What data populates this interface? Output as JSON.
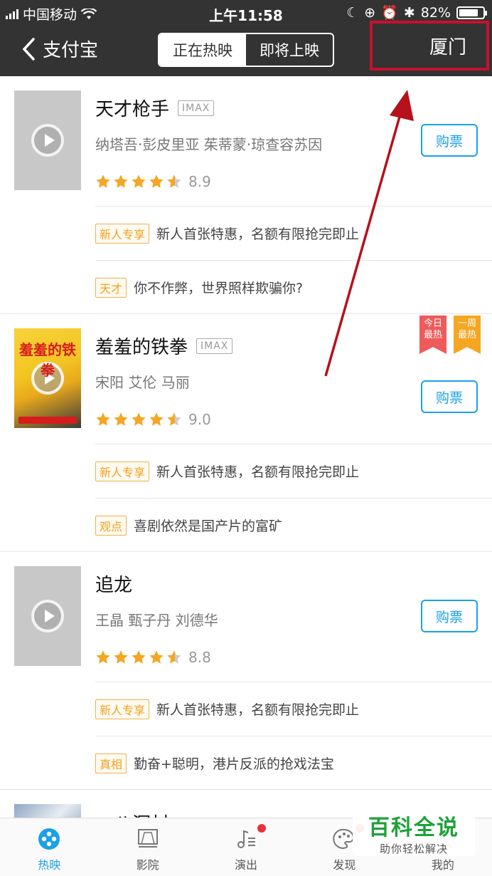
{
  "status": {
    "carrier": "中国移动",
    "time": "上午11:58",
    "battery": "82%",
    "battery_level": 0.82
  },
  "nav": {
    "back_label": "支付宝",
    "tabs": [
      "正在热映",
      "即将上映"
    ],
    "active_tab": 0,
    "city": "厦门"
  },
  "movies": [
    {
      "title": "天才枪手",
      "format": "IMAX",
      "cast": "纳塔吾·彭皮里亚 茱蒂蒙·琼查容苏因",
      "score": "8.9",
      "buy_label": "购票",
      "promos": [
        {
          "tag": "新人专享",
          "text": "新人首张特惠，名额有限抢完即止"
        },
        {
          "tag": "天才",
          "text": "你不作弊，世界照样欺骗你?"
        }
      ]
    },
    {
      "title": "羞羞的铁拳",
      "format": "IMAX",
      "cast": "宋阳 艾伦 马丽",
      "score": "9.0",
      "buy_label": "购票",
      "poster_text": "羞羞的铁拳",
      "ribbons": [
        {
          "text": "今日 最热",
          "color": "#ef5b5b"
        },
        {
          "text": "一周 最热",
          "color": "#f5a623"
        }
      ],
      "promos": [
        {
          "tag": "新人专享",
          "text": "新人首张特惠，名额有限抢完即止"
        },
        {
          "tag": "观点",
          "text": "喜剧依然是国产片的富矿"
        }
      ]
    },
    {
      "title": "追龙",
      "format": "",
      "cast": "王晶 甄子丹 刘德华",
      "score": "8.8",
      "buy_label": "购票",
      "promos": [
        {
          "tag": "新人专享",
          "text": "新人首张特惠，名额有限抢完即止"
        },
        {
          "tag": "真相",
          "text": "勤奋+聪明，港片反派的抢戏法宝"
        }
      ]
    }
  ],
  "partial_title": "一八洞村",
  "tabbar": [
    {
      "label": "热映",
      "icon": "film-reel-icon",
      "active": true
    },
    {
      "label": "影院",
      "icon": "cinema-screen-icon",
      "active": false
    },
    {
      "label": "演出",
      "icon": "music-note-icon",
      "active": false,
      "badge": true
    },
    {
      "label": "发现",
      "icon": "palette-icon",
      "active": false,
      "badge": true
    },
    {
      "label": "我的",
      "icon": "person-icon",
      "active": false
    }
  ],
  "watermark": {
    "main": "百科全说",
    "sub": "助你轻松解决"
  },
  "colors": {
    "header_bg": "#333333",
    "accent": "#1aa1e6",
    "highlight_box": "#c8102e",
    "star": "#f5a623",
    "promo_tag": "#f0a020"
  }
}
